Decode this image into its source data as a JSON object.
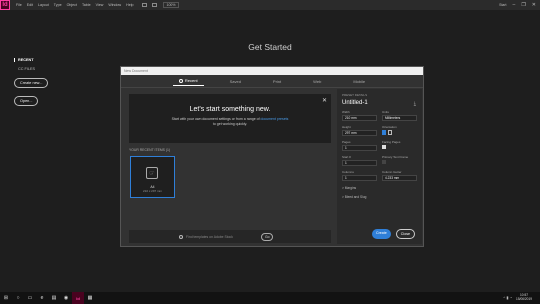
{
  "app": {
    "logo": "Id"
  },
  "menubar": {
    "items": [
      "File",
      "Edit",
      "Layout",
      "Type",
      "Object",
      "Table",
      "View",
      "Window",
      "Help"
    ],
    "zoom": "100%",
    "start_label": "Start",
    "search_icon": "search-icon"
  },
  "left_panel": {
    "recent": "RECENT",
    "cc_files": "CC FILES",
    "create_new": "Create new...",
    "open": "Open..."
  },
  "page_title": "Get Started",
  "dialog": {
    "title": "New Document",
    "tabs": [
      "Recent",
      "Saved",
      "Print",
      "Web",
      "Mobile"
    ],
    "active_tab": "Recent",
    "welcome": {
      "title": "Let's start something new.",
      "line1_pre": "Start with your own document settings or from a range of",
      "line1_link": "document presets",
      "line2": "to get working quickly."
    },
    "recent_items_label": "YOUR RECENT ITEMS (1)",
    "recent_card": {
      "name": "A4",
      "size": "210 x 297 mm"
    },
    "search": {
      "placeholder": "Find templates on Adobe Stock",
      "go": "Go"
    },
    "preset": {
      "label": "PRESET DETAILS",
      "title": "Untitled-1",
      "width_label": "Width",
      "width_value": "210 mm",
      "units_label": "Units",
      "units_value": "Millimeters",
      "height_label": "Height",
      "height_value": "297 mm",
      "orientation_label": "Orientation",
      "pages_label": "Pages",
      "pages_value": "1",
      "facing_label": "Facing Pages",
      "facing_checked": true,
      "start_label": "Start #",
      "start_value": "1",
      "primary_label": "Primary Text Frame",
      "columns_label": "Columns",
      "columns_value": "1",
      "gutter_label": "Column Gutter",
      "gutter_value": "4.233 mm",
      "margins": "> Margins",
      "bleed": "> Bleed and Slug",
      "create": "Create",
      "close": "Close"
    }
  },
  "taskbar": {
    "clock_time": "10:57",
    "clock_date": "15/06/2019"
  }
}
